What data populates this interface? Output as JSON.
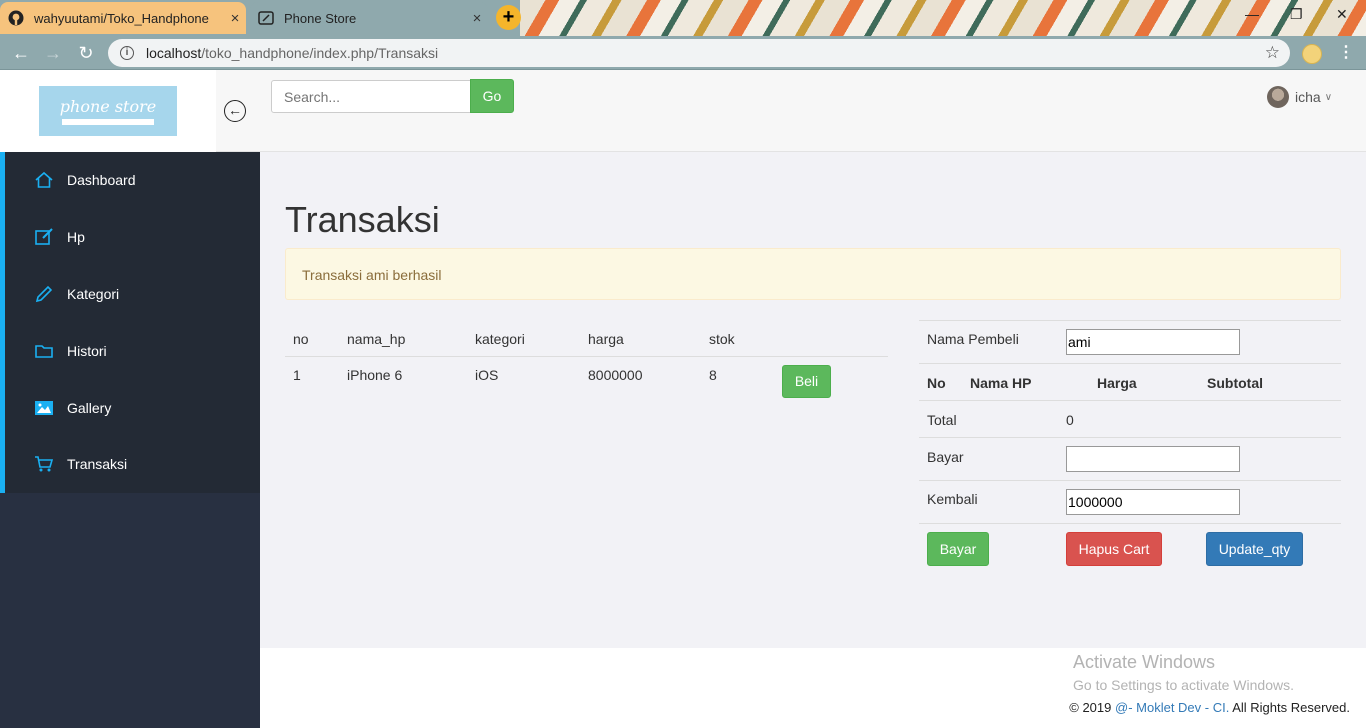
{
  "browser": {
    "tabs": [
      {
        "title": "wahyuutami/Toko_Handphone",
        "icon": "github-icon"
      },
      {
        "title": "Phone Store",
        "icon": "page-icon"
      }
    ],
    "url_host": "localhost",
    "url_path": "/toko_handphone/index.php/Transaksi",
    "close_glyph": "×",
    "new_tab_glyph": "+"
  },
  "app": {
    "logo_text": "phone store",
    "search_placeholder": "Search...",
    "go_label": "Go",
    "user_name": "icha"
  },
  "sidebar": {
    "items": [
      {
        "label": "Dashboard",
        "icon": "home-icon"
      },
      {
        "label": "Hp",
        "icon": "edit-icon"
      },
      {
        "label": "Kategori",
        "icon": "pencil-icon"
      },
      {
        "label": "Histori",
        "icon": "folder-icon"
      },
      {
        "label": "Gallery",
        "icon": "image-icon"
      },
      {
        "label": "Transaksi",
        "icon": "cart-icon"
      }
    ]
  },
  "main": {
    "title": "Transaksi",
    "alert": "Transaksi ami berhasil",
    "products": {
      "headers": [
        "no",
        "nama_hp",
        "kategori",
        "harga",
        "stok"
      ],
      "rows": [
        {
          "no": "1",
          "nama_hp": "iPhone 6",
          "kategori": "iOS",
          "harga": "8000000",
          "stok": "8"
        }
      ],
      "buy_label": "Beli"
    },
    "cart": {
      "buyer_label": "Nama Pembeli",
      "buyer_value": "ami",
      "headers": [
        "No",
        "Nama HP",
        "Harga",
        "Subtotal"
      ],
      "total_label": "Total",
      "total_value": "0",
      "pay_label": "Bayar",
      "pay_value": "",
      "change_label": "Kembali",
      "change_value": "1000000",
      "btn_pay": "Bayar",
      "btn_clear": "Hapus Cart",
      "btn_update": "Update_qty"
    }
  },
  "footer": {
    "watermark_title": "Activate Windows",
    "watermark_sub": "Go to Settings to activate Windows.",
    "copy_prefix": "© 2019 ",
    "copy_link": "@- Moklet Dev - CI.",
    "copy_suffix": " All Rights Reserved."
  },
  "colors": {
    "accent": "#1ab0f2",
    "success": "#5cb85c",
    "danger": "#d9534f",
    "primary": "#337ab7"
  }
}
